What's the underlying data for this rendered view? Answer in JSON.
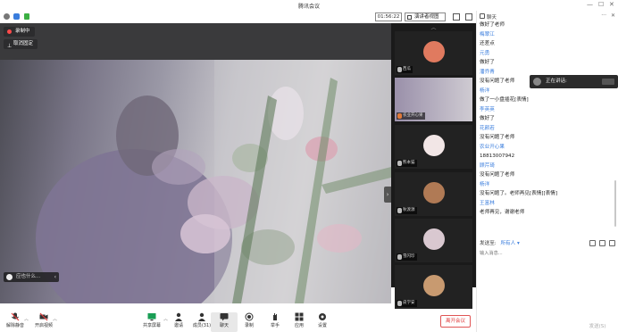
{
  "window": {
    "title": "腾讯会议",
    "controls": [
      "—",
      "☐",
      "✕"
    ]
  },
  "topbar": {
    "timer": "01:56:22",
    "view_mode": "演讲者视图"
  },
  "main_video": {
    "recording_label": "录制中",
    "unpin_label": "取消固定",
    "speaker_name": "应也什么..."
  },
  "strip": {
    "participants": [
      {
        "name": "西瓜",
        "avatar_color": "#e07a5f"
      },
      {
        "name": "农业开心果",
        "avatar_color": "#8a7ba0"
      },
      {
        "name": "熊本猫",
        "avatar_color": "#f2e6e6"
      },
      {
        "name": "秋渡源",
        "avatar_color": "#b07a55"
      },
      {
        "name": "雪闪珍",
        "avatar_color": "#d9c8d0"
      },
      {
        "name": "皮学安",
        "avatar_color": "#c89a70"
      }
    ]
  },
  "toolbar": {
    "unmute": "解除静音",
    "start_video": "开启视频",
    "share_screen": "共享屏幕",
    "invite": "邀请",
    "members": "成员(31)",
    "chat": "聊天",
    "record": "录制",
    "raise_hand": "举手",
    "apps": "应用",
    "settings": "设置",
    "leave": "离开会议"
  },
  "chat": {
    "header": "聊天",
    "messages": [
      {
        "type": "text",
        "text": "做好了老师"
      },
      {
        "type": "sender",
        "text": "梅翠江"
      },
      {
        "type": "text",
        "text": "还差点"
      },
      {
        "type": "sender",
        "text": "元勇"
      },
      {
        "type": "text",
        "text": "做好了"
      },
      {
        "type": "sender",
        "text": "潘乔青"
      },
      {
        "type": "text",
        "text": "没有问题了老师"
      },
      {
        "type": "sender",
        "text": "杨洋"
      },
      {
        "type": "text",
        "text": "做了一小盘插花[表情]"
      },
      {
        "type": "sender",
        "text": "李英英"
      },
      {
        "type": "text",
        "text": "做好了"
      },
      {
        "type": "sender",
        "text": "花颜若"
      },
      {
        "type": "text",
        "text": "没有问题了老师"
      },
      {
        "type": "sender",
        "text": "农业开心果"
      },
      {
        "type": "text",
        "text": "18813007942"
      },
      {
        "type": "sender",
        "text": "顾芹琦"
      },
      {
        "type": "text",
        "text": "没有问题了老师"
      },
      {
        "type": "sender",
        "text": "杨洋"
      },
      {
        "type": "text",
        "text": "没有问题了。老师再见[表情][表情]"
      },
      {
        "type": "sender",
        "text": "王富林"
      },
      {
        "type": "text",
        "text": "老师再见，谢谢老师"
      }
    ],
    "speaking_label": "正在讲话:",
    "send_to_label": "发送至:",
    "send_to_value": "所有人",
    "input_placeholder": "输入消息...",
    "send_button": "发送(S)"
  },
  "colors": {
    "accent_blue": "#3a7ddd",
    "leave_red": "#e03e3e",
    "recording_red": "#ff4a4a"
  }
}
